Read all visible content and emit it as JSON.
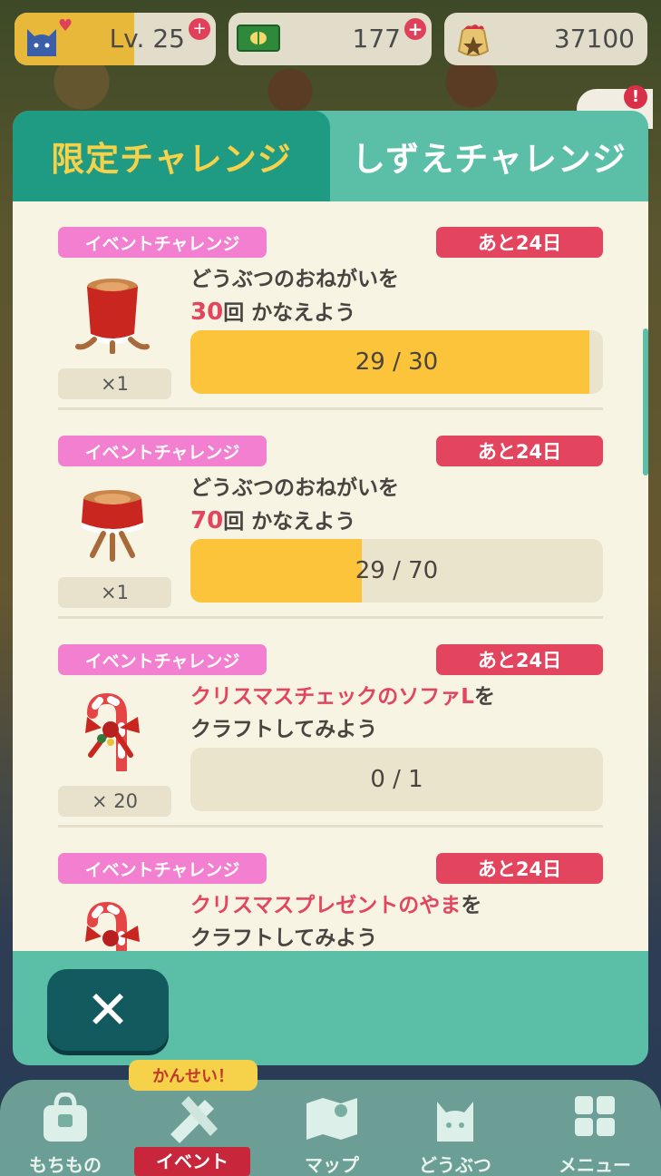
{
  "status_bar": {
    "level": "Lv. 25",
    "tickets": "177",
    "bells": "37100",
    "icons": [
      "cat-face-icon",
      "heart-icon",
      "zoom-plus-icon",
      "leaf-ticket-icon",
      "plus-icon",
      "bell-bag-icon"
    ]
  },
  "alert": {
    "symbol": "!"
  },
  "tabs": [
    {
      "label": "限定チャレンジ",
      "active": true
    },
    {
      "label": "しずえチャレンジ",
      "active": false
    }
  ],
  "challenges": [
    {
      "badge": "イベントチャレンジ",
      "remaining": "あと24日",
      "item_icon": "red-stump-table-icon",
      "quantity": "×1",
      "line1_prefix": "",
      "line1_highlight": "",
      "line1_text": "どうぶつのおねがいを",
      "line2_highlight": "30",
      "line2_text": "回 かなえよう",
      "progress_text": "29 / 30",
      "progress_fraction": 0.9667
    },
    {
      "badge": "イベントチャレンジ",
      "remaining": "あと24日",
      "item_icon": "red-stump-stool-icon",
      "quantity": "×1",
      "line1_prefix": "",
      "line1_highlight": "",
      "line1_text": "どうぶつのおねがいを",
      "line2_highlight": "70",
      "line2_text": "回 かなえよう",
      "progress_text": "29 / 70",
      "progress_fraction": 0.4143
    },
    {
      "badge": "イベントチャレンジ",
      "remaining": "あと24日",
      "item_icon": "candy-cane-icon",
      "quantity": "× 20",
      "line1_prefix": "",
      "line1_highlight": "クリスマスチェックのソファL",
      "line1_text": "を",
      "line2_highlight": "",
      "line2_text": "クラフトしてみよう",
      "progress_text": "0 / 1",
      "progress_fraction": 0
    },
    {
      "badge": "イベントチャレンジ",
      "remaining": "あと24日",
      "item_icon": "candy-cane-icon",
      "quantity": "",
      "line1_prefix": "",
      "line1_highlight": "クリスマスプレゼントのやま",
      "line1_text": "を",
      "line2_highlight": "",
      "line2_text": "クラフトしてみよう",
      "progress_text": "",
      "progress_fraction": 0
    }
  ],
  "close_button": {
    "icon": "close-icon"
  },
  "bottom_nav": {
    "kansei_label": "かんせい！",
    "items": [
      {
        "label": "もちもの",
        "icon": "bag-icon"
      },
      {
        "label": "イベント",
        "icon": "craft-tools-icon",
        "active": true
      },
      {
        "label": "マップ",
        "icon": "map-icon"
      },
      {
        "label": "どうぶつ",
        "icon": "animal-face-icon"
      },
      {
        "label": "メニュー",
        "icon": "menu-grid-icon"
      }
    ]
  },
  "colors": {
    "modal_teal": "#5bbfa8",
    "active_tab": "#1f9a83",
    "tab_gold": "#f6d24a",
    "event_pink": "#f27fcf",
    "days_red": "#e3455f",
    "progress_yellow": "#fbc43a",
    "close_dark": "#135a5e"
  }
}
